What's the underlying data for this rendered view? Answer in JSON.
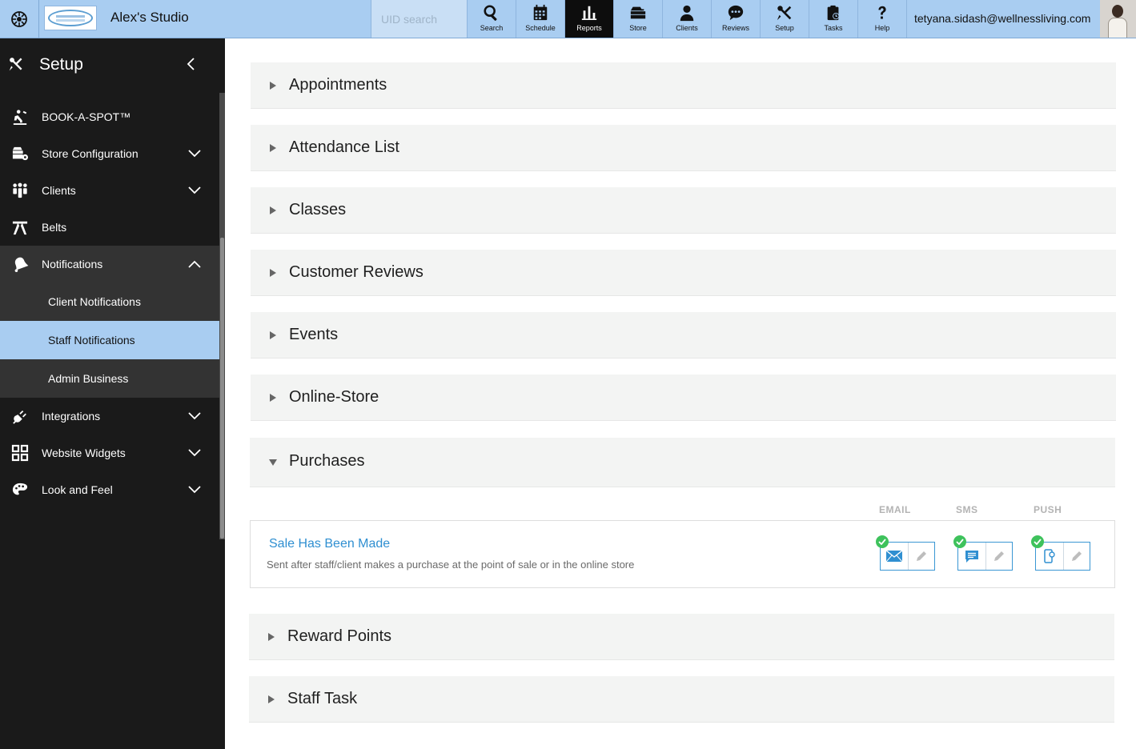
{
  "topbar": {
    "studio_name": "Alex's Studio",
    "uid_placeholder": "UID search",
    "user_email": "tetyana.sidash@wellnessliving.com",
    "nav": [
      {
        "label": "Search",
        "icon": "search-icon"
      },
      {
        "label": "Schedule",
        "icon": "calendar-icon"
      },
      {
        "label": "Reports",
        "icon": "bar-chart-icon",
        "active": true
      },
      {
        "label": "Store",
        "icon": "store-icon"
      },
      {
        "label": "Clients",
        "icon": "person-icon"
      },
      {
        "label": "Reviews",
        "icon": "speech-bubble-icon"
      },
      {
        "label": "Setup",
        "icon": "tools-icon"
      },
      {
        "label": "Tasks",
        "icon": "clipboard-icon"
      },
      {
        "label": "Help",
        "icon": "question-icon"
      }
    ]
  },
  "sidebar": {
    "title": "Setup",
    "items": [
      {
        "label": "BOOK-A-SPOT™",
        "icon": "book-a-spot-icon"
      },
      {
        "label": "Store Configuration",
        "icon": "store-config-icon",
        "expandable": true
      },
      {
        "label": "Clients",
        "icon": "clients-group-icon",
        "expandable": true
      },
      {
        "label": "Belts",
        "icon": "belt-icon"
      },
      {
        "label": "Notifications",
        "icon": "bell-icon",
        "expandable": true,
        "expanded": true
      },
      {
        "label": "Integrations",
        "icon": "plug-icon",
        "expandable": true
      },
      {
        "label": "Website Widgets",
        "icon": "grid-widgets-icon",
        "expandable": true
      },
      {
        "label": "Look and Feel",
        "icon": "palette-icon",
        "expandable": true
      }
    ],
    "sub_items": [
      {
        "label": "Client Notifications"
      },
      {
        "label": "Staff Notifications",
        "selected": true
      },
      {
        "label": "Admin Business"
      }
    ]
  },
  "main": {
    "sections": [
      {
        "title": "Appointments",
        "expanded": false
      },
      {
        "title": "Attendance List",
        "expanded": false
      },
      {
        "title": "Classes",
        "expanded": false
      },
      {
        "title": "Customer Reviews",
        "expanded": false
      },
      {
        "title": "Events",
        "expanded": false
      },
      {
        "title": "Online-Store",
        "expanded": false
      },
      {
        "title": "Purchases",
        "expanded": true
      },
      {
        "title": "Reward Points",
        "expanded": false
      },
      {
        "title": "Staff Task",
        "expanded": false
      }
    ],
    "channels": [
      "EMAIL",
      "SMS",
      "PUSH"
    ],
    "notification": {
      "title": "Sale Has Been Made",
      "description": "Sent after staff/client makes a purchase at the point of sale or in the online store",
      "email_enabled": true,
      "sms_enabled": true,
      "push_enabled": true
    }
  },
  "colors": {
    "topbar": "#a9cdf1",
    "sidebar": "#1a1a1a",
    "accent": "#2f8fd1",
    "check": "#3ec25c"
  }
}
